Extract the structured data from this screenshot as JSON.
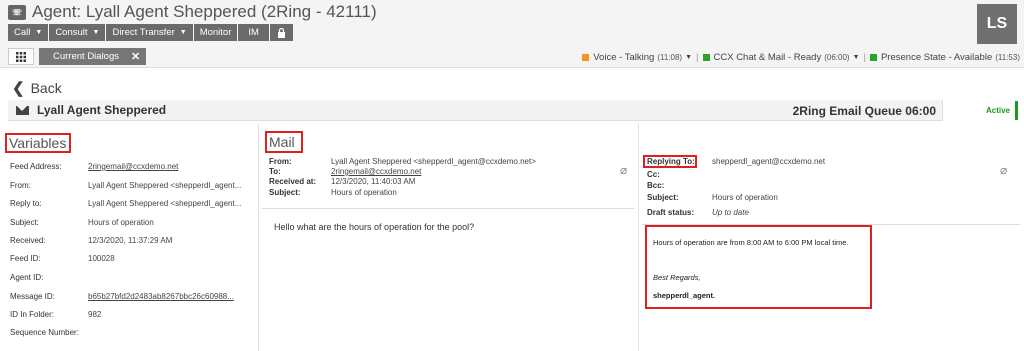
{
  "header": {
    "title": "Agent: Lyall Agent Sheppered (2Ring - 42111)",
    "avatar_initials": "LS",
    "toolbar": {
      "call": "Call",
      "consult": "Consult",
      "direct_transfer": "Direct Transfer",
      "monitor": "Monitor",
      "im": "IM"
    },
    "current_dialogs_tab": "Current Dialogs",
    "status": {
      "voice_label": "Voice - Talking",
      "voice_time": "(11:08)",
      "voice_color": "#f7941d",
      "ccx_label": "CCX Chat & Mail - Ready",
      "ccx_time": "(06:00)",
      "ccx_color": "#2aa52a",
      "presence_label": "Presence State - Available",
      "presence_time": "(11:53)",
      "presence_color": "#2aa52a"
    }
  },
  "back_label": "Back",
  "subject_bar": {
    "agent_name": "Lyall Agent Sheppered",
    "queue": "2Ring Email Queue 06:00",
    "status": "Active"
  },
  "variables": {
    "heading": "Variables",
    "rows": [
      {
        "label": "Feed Address:",
        "value": "2ringemail@ccxdemo.net"
      },
      {
        "label": "From:",
        "value": "Lyall Agent Sheppered <shepperdl_agent..."
      },
      {
        "label": "Reply to:",
        "value": "Lyall Agent Sheppered <shepperdl_agent..."
      },
      {
        "label": "Subject:",
        "value": "Hours of operation"
      },
      {
        "label": "Received:",
        "value": "12/3/2020, 11:37:29 AM"
      },
      {
        "label": "Feed ID:",
        "value": "100028"
      },
      {
        "label": "Agent ID:",
        "value": ""
      },
      {
        "label": "Message ID:",
        "value": "b65b27bfd2d2483ab8267bbc26c60988..."
      },
      {
        "label": "ID In Folder:",
        "value": "982"
      },
      {
        "label": "Sequence Number:",
        "value": ""
      }
    ]
  },
  "mail": {
    "heading": "Mail",
    "from_label": "From:",
    "from_value": "Lyall Agent Sheppered <shepperdl_agent@ccxdemo.net>",
    "to_label": "To:",
    "to_value": "2ringemail@ccxdemo.net",
    "received_label": "Received at:",
    "received_value": "12/3/2020, 11:40:03 AM",
    "subject_label": "Subject:",
    "subject_value": "Hours of operation",
    "body": "Hello what are the hours of operation for the pool?"
  },
  "reply": {
    "replying_to_label": "Replying To:",
    "replying_to_value": "shepperdl_agent@ccxdemo.net",
    "cc_label": "Cc:",
    "bcc_label": "Bcc:",
    "subject_label": "Subject:",
    "subject_value": "Hours of operation",
    "draft_label": "Draft status:",
    "draft_value": "Up to date",
    "body_line1": "Hours of operation are from 8:00 AM to 6:00 PM local time.",
    "body_line2": "Best Regards,",
    "body_line3": "shepperdl_agent."
  }
}
